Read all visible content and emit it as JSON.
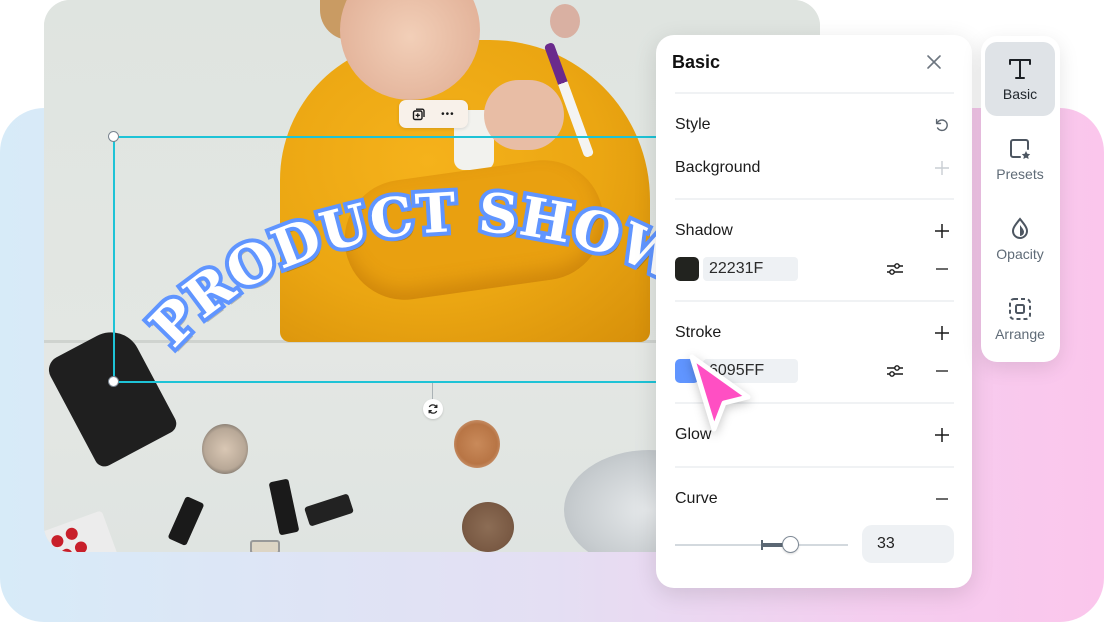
{
  "canvas": {
    "text_element": {
      "text": "PRODUCT SHOWCASE",
      "fill_color": "#FFFFFF",
      "stroke_color": "#6095FF",
      "shadow_color": "#22231F"
    },
    "float_toolbar": {
      "duplicate_icon": "duplicate-icon",
      "more_icon": "more-icon",
      "more_label": "•••"
    },
    "rotate_icon": "rotate-icon"
  },
  "panel": {
    "title": "Basic",
    "close_icon": "close-icon",
    "style": {
      "label": "Style",
      "action_icon": "reset-icon"
    },
    "background": {
      "label": "Background",
      "action_icon": "plus-icon"
    },
    "shadow": {
      "label": "Shadow",
      "color_hex": "22231F",
      "swatch_color": "#22231F",
      "add_icon": "plus-icon",
      "adjust_icon": "sliders-icon",
      "remove_icon": "minus-icon"
    },
    "stroke": {
      "label": "Stroke",
      "color_hex": "6095FF",
      "swatch_color": "#6095FF",
      "add_icon": "plus-icon",
      "adjust_icon": "sliders-icon",
      "remove_icon": "minus-icon"
    },
    "glow": {
      "label": "Glow",
      "action_icon": "plus-icon"
    },
    "curve": {
      "label": "Curve",
      "action_icon": "minus-icon",
      "value": "33",
      "slider_value": 33,
      "slider_min": -100,
      "slider_max": 100
    }
  },
  "rail": {
    "items": [
      {
        "label": "Basic",
        "icon": "text-icon",
        "active": true
      },
      {
        "label": "Presets",
        "icon": "presets-icon",
        "active": false
      },
      {
        "label": "Opacity",
        "icon": "opacity-icon",
        "active": false
      },
      {
        "label": "Arrange",
        "icon": "arrange-icon",
        "active": false
      }
    ]
  },
  "accent_colors": {
    "selection": "#1EC3D6",
    "cursor": "#FF4FC3"
  }
}
